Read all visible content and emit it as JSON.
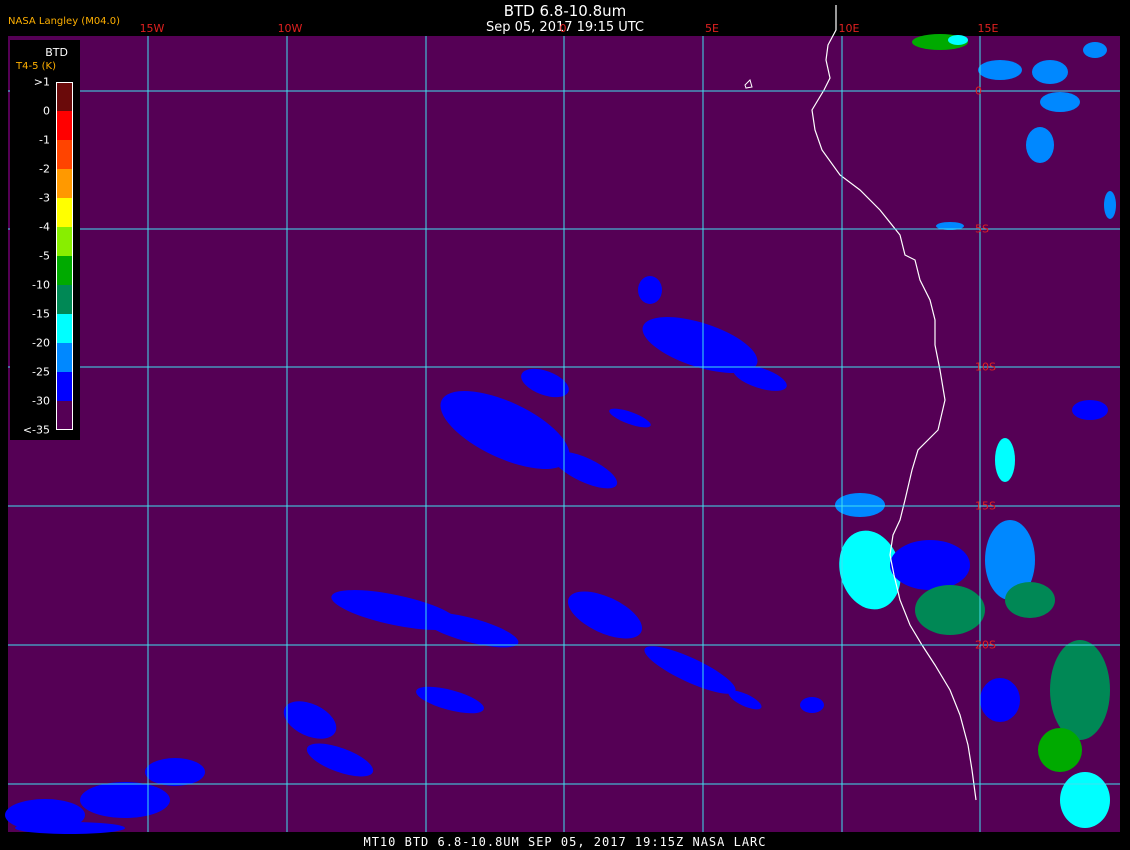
{
  "header": {
    "title": "BTD 6.8-10.8um",
    "timestamp": "Sep 05, 2017 19:15 UTC",
    "provider": "NASA Langley (M04.0)"
  },
  "legend": {
    "variable": "BTD",
    "subtitle": "T4-5 (K)",
    "entries": [
      {
        "label": ">1",
        "color": "#6a0a0a"
      },
      {
        "label": "0",
        "color": "#ff0000"
      },
      {
        "label": "-1",
        "color": "#ff4400"
      },
      {
        "label": "-2",
        "color": "#ff9900"
      },
      {
        "label": "-3",
        "color": "#ffff00"
      },
      {
        "label": "-4",
        "color": "#88ee00"
      },
      {
        "label": "-5",
        "color": "#00aa00"
      },
      {
        "label": "-10",
        "color": "#008855"
      },
      {
        "label": "-15",
        "color": "#00ffff"
      },
      {
        "label": "-20",
        "color": "#0088ff"
      },
      {
        "label": "-25",
        "color": "#0000ff"
      },
      {
        "label": "-30",
        "color": "#550055"
      },
      {
        "label": "<-35",
        "color": null
      }
    ]
  },
  "longitude_labels": [
    "15W",
    "10W",
    "0",
    "5E",
    "10E",
    "15E"
  ],
  "latitude_labels": [
    "0",
    "5S",
    "10S",
    "15S",
    "20S"
  ],
  "footer": "MT10  BTD 6.8-10.8UM  SEP 05, 2017 19:15Z  NASA LARC",
  "colors": {
    "background": "#550055",
    "gridline": "#40e0f0",
    "coastline": "#ffffff",
    "label": "#e02020",
    "provider": "#ffb000",
    "cloud_deep": "#0000ff",
    "cloud_mid": "#0088ff",
    "cloud_cyan": "#00ffff",
    "cloud_green": "#008855",
    "cloud_bright_green": "#00aa00"
  }
}
